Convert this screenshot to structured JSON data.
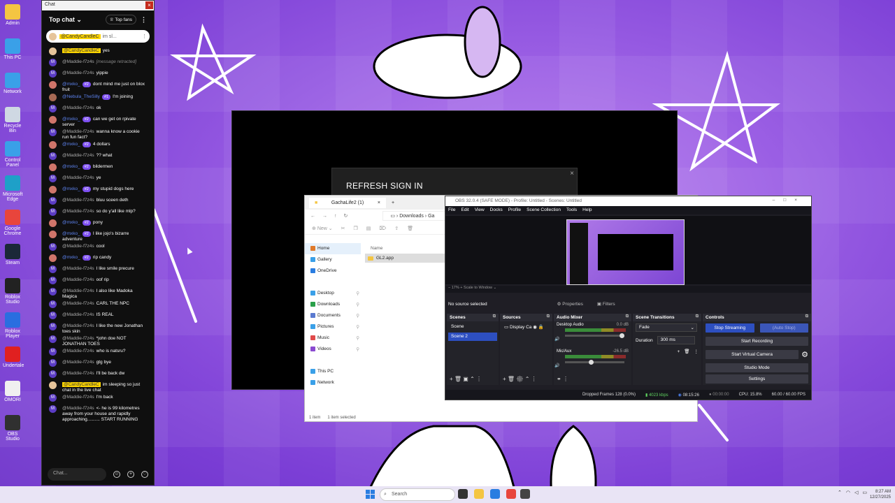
{
  "desktop": {
    "icons": [
      {
        "label": "Admin",
        "color": "#f4c542"
      },
      {
        "label": "This PC",
        "color": "#3aa0e8"
      },
      {
        "label": "Network",
        "color": "#3aa0e8"
      },
      {
        "label": "Recycle Bin",
        "color": "#cfd8e3"
      },
      {
        "label": "Control Panel",
        "color": "#3aa0e8"
      },
      {
        "label": "Microsoft Edge",
        "color": "#1ea0c8"
      },
      {
        "label": "Google Chrome",
        "color": "#e8453c"
      },
      {
        "label": "Steam",
        "color": "#1b2838"
      },
      {
        "label": "Roblox Studio",
        "color": "#222222"
      },
      {
        "label": "Roblox Player",
        "color": "#2a6ee0"
      },
      {
        "label": "Undertale",
        "color": "#e02020"
      },
      {
        "label": "OMORI",
        "color": "#f0f0f0"
      },
      {
        "label": "OBS Studio",
        "color": "#303030"
      }
    ]
  },
  "chat": {
    "window_title": "Chat",
    "header_title": "Top chat",
    "top_fans": "Top fans",
    "pinned": {
      "user": "@CandyCandleC",
      "text": "im sl..."
    },
    "input_placeholder": "Chat...",
    "messages": [
      {
        "av": "c",
        "user": "@CandyCandleC",
        "style": "hl",
        "badge": "",
        "text": "yes"
      },
      {
        "av": "m",
        "user": "@Maddie-f7z4s",
        "style": "",
        "badge": "",
        "text": "[message retracted]",
        "retracted": true
      },
      {
        "av": "m",
        "user": "@Maddie-f7z4s",
        "style": "",
        "badge": "",
        "text": "yippie"
      },
      {
        "av": "r",
        "user": "@mxko_",
        "style": "blue",
        "badge": "#2",
        "text": "dont mind me just on blox fruit"
      },
      {
        "av": "n",
        "user": "@Nebula_TheSilly",
        "style": "blue",
        "badge": "#1",
        "text": "I'm joining"
      },
      {
        "av": "m",
        "user": "@Maddie-f7z4s",
        "style": "",
        "badge": "",
        "text": "ok"
      },
      {
        "av": "r",
        "user": "@mxko_",
        "style": "blue",
        "badge": "#2",
        "text": "can we get on rpivate server"
      },
      {
        "av": "m",
        "user": "@Maddie-f7z4s",
        "style": "",
        "badge": "",
        "text": "wanna know a cookie run fun fact?"
      },
      {
        "av": "r",
        "user": "@mxko_",
        "style": "blue",
        "badge": "#2",
        "text": "4 dollars"
      },
      {
        "av": "m",
        "user": "@Maddie-f7z4s",
        "style": "",
        "badge": "",
        "text": "?? what"
      },
      {
        "av": "r",
        "user": "@mxko_",
        "style": "blue",
        "badge": "#2",
        "text": "bildermen"
      },
      {
        "av": "m",
        "user": "@Maddie-f7z4s",
        "style": "",
        "badge": "",
        "text": "ye"
      },
      {
        "av": "r",
        "user": "@mxko_",
        "style": "blue",
        "badge": "#2",
        "text": "my stupid dogs here"
      },
      {
        "av": "m",
        "user": "@Maddie-f7z4s",
        "style": "",
        "badge": "",
        "text": "bluu sceen deth"
      },
      {
        "av": "m",
        "user": "@Maddie-f7z4s",
        "style": "",
        "badge": "",
        "text": "so do y'all like mlp?"
      },
      {
        "av": "r",
        "user": "@mxko_",
        "style": "blue",
        "badge": "#2",
        "text": "pony"
      },
      {
        "av": "r",
        "user": "@mxko_",
        "style": "blue",
        "badge": "#2",
        "text": "I like jojo's bizarre adventure"
      },
      {
        "av": "m",
        "user": "@Maddie-f7z4s",
        "style": "",
        "badge": "",
        "text": "cool"
      },
      {
        "av": "r",
        "user": "@mxko_",
        "style": "blue",
        "badge": "#2",
        "text": "rip candy"
      },
      {
        "av": "m",
        "user": "@Maddie-f7z4s",
        "style": "",
        "badge": "",
        "text": "I like smile precure"
      },
      {
        "av": "m",
        "user": "@Maddie-f7z4s",
        "style": "",
        "badge": "",
        "text": "oof rip"
      },
      {
        "av": "m",
        "user": "@Maddie-f7z4s",
        "style": "",
        "badge": "",
        "text": "I also like Madoka Magica"
      },
      {
        "av": "m",
        "user": "@Maddie-f7z4s",
        "style": "",
        "badge": "",
        "text": "CARL THE NPC"
      },
      {
        "av": "m",
        "user": "@Maddie-f7z4s",
        "style": "",
        "badge": "",
        "text": "IS REAL"
      },
      {
        "av": "m",
        "user": "@Maddie-f7z4s",
        "style": "",
        "badge": "",
        "text": "I like the new Jonathan toes skin"
      },
      {
        "av": "m",
        "user": "@Maddie-f7z4s",
        "style": "",
        "badge": "",
        "text": "*john doe NOT JONATHAN TOES"
      },
      {
        "av": "m",
        "user": "@Maddie-f7z4s",
        "style": "",
        "badge": "",
        "text": "who is natsru?"
      },
      {
        "av": "m",
        "user": "@Maddie-f7z4s",
        "style": "",
        "badge": "",
        "text": "gtg bye"
      },
      {
        "av": "m",
        "user": "@Maddie-f7z4s",
        "style": "",
        "badge": "",
        "text": "I'll be back dw"
      },
      {
        "av": "c",
        "user": "@CandyCandleC",
        "style": "hl",
        "badge": "",
        "text": "im sleeping so just chat in the live chat"
      },
      {
        "av": "m",
        "user": "@Maddie-f7z4s",
        "style": "",
        "badge": "",
        "text": "I'm back"
      },
      {
        "av": "m",
        "user": "@Maddie-f7z4s",
        "style": "",
        "badge": "",
        "text": "<- he is 99 kilometres away from your house and rapidly approaching.......... START RUNNING"
      }
    ]
  },
  "dialog": {
    "title": "REFRESH SIGN IN",
    "close": "×"
  },
  "explorer": {
    "tab": "GachaLife2 (1)",
    "path": "Downloads",
    "path_more": "Ga",
    "new_label": "New",
    "nav": [
      {
        "label": "Home",
        "color": "#e07a2a",
        "sel": true,
        "pin": false
      },
      {
        "label": "Gallery",
        "color": "#3aa0e8",
        "sel": false,
        "pin": false
      },
      {
        "label": "OneDrive",
        "color": "#2a7de1",
        "sel": false,
        "pin": false
      },
      {
        "label": "",
        "color": "",
        "sel": false,
        "pin": false
      },
      {
        "label": "Desktop",
        "color": "#3aa0e8",
        "sel": false,
        "pin": true
      },
      {
        "label": "Downloads",
        "color": "#2aa04a",
        "sel": false,
        "pin": true
      },
      {
        "label": "Documents",
        "color": "#5a7ad0",
        "sel": false,
        "pin": true
      },
      {
        "label": "Pictures",
        "color": "#3aa0e8",
        "sel": false,
        "pin": true
      },
      {
        "label": "Music",
        "color": "#e04a4a",
        "sel": false,
        "pin": true
      },
      {
        "label": "Videos",
        "color": "#8a4ad0",
        "sel": false,
        "pin": true
      },
      {
        "label": "",
        "color": "",
        "sel": false,
        "pin": false
      },
      {
        "label": "This PC",
        "color": "#3aa0e8",
        "sel": false,
        "pin": false
      },
      {
        "label": "Network",
        "color": "#3aa0e8",
        "sel": false,
        "pin": false
      }
    ],
    "col_name": "Name",
    "file": "GL2.app",
    "status_items": "1 item",
    "status_selected": "1 item selected"
  },
  "obs": {
    "title": "OBS 32.0.4 (SAFE MODE) - Profile: Untitled - Scenes: Untitled",
    "menu": [
      "File",
      "Edit",
      "View",
      "Docks",
      "Profile",
      "Scene Collection",
      "Tools",
      "Help"
    ],
    "zoom": "17%",
    "scale": "Scale to Window",
    "no_source": "No source selected",
    "properties": "Properties",
    "filters": "Filters",
    "docks": {
      "scenes": "Scenes",
      "sources": "Sources",
      "mixer": "Audio Mixer",
      "transitions": "Scene Transitions",
      "controls": "Controls"
    },
    "scene_list": [
      "Scene",
      "Scene 2"
    ],
    "source": "Display Ca",
    "mixer": [
      {
        "name": "Desktop Audio",
        "db": "0.0 dB",
        "level": 0.92
      },
      {
        "name": "Mic/Aux",
        "db": "-26.5 dB",
        "level": 0.4
      }
    ],
    "transition": "Fade",
    "duration_label": "Duration",
    "duration": "300 ms",
    "controls": {
      "stream": "Stop Streaming",
      "autostop": "(Auto Stop)",
      "record": "Start Recording",
      "vcam": "Start Virtual Camera",
      "studio": "Studio Mode",
      "settings": "Settings"
    },
    "status": {
      "dropped": "Dropped Frames 128 (0.0%)",
      "kbps": "4023 kbps",
      "live": "08:15:26",
      "rec": "00:00:00",
      "cpu": "CPU: 15.8%",
      "fps": "60.00 / 60.00 FPS"
    }
  },
  "taskbar": {
    "search": "Search",
    "time": "8:27 AM",
    "date": "12/27/2025"
  }
}
